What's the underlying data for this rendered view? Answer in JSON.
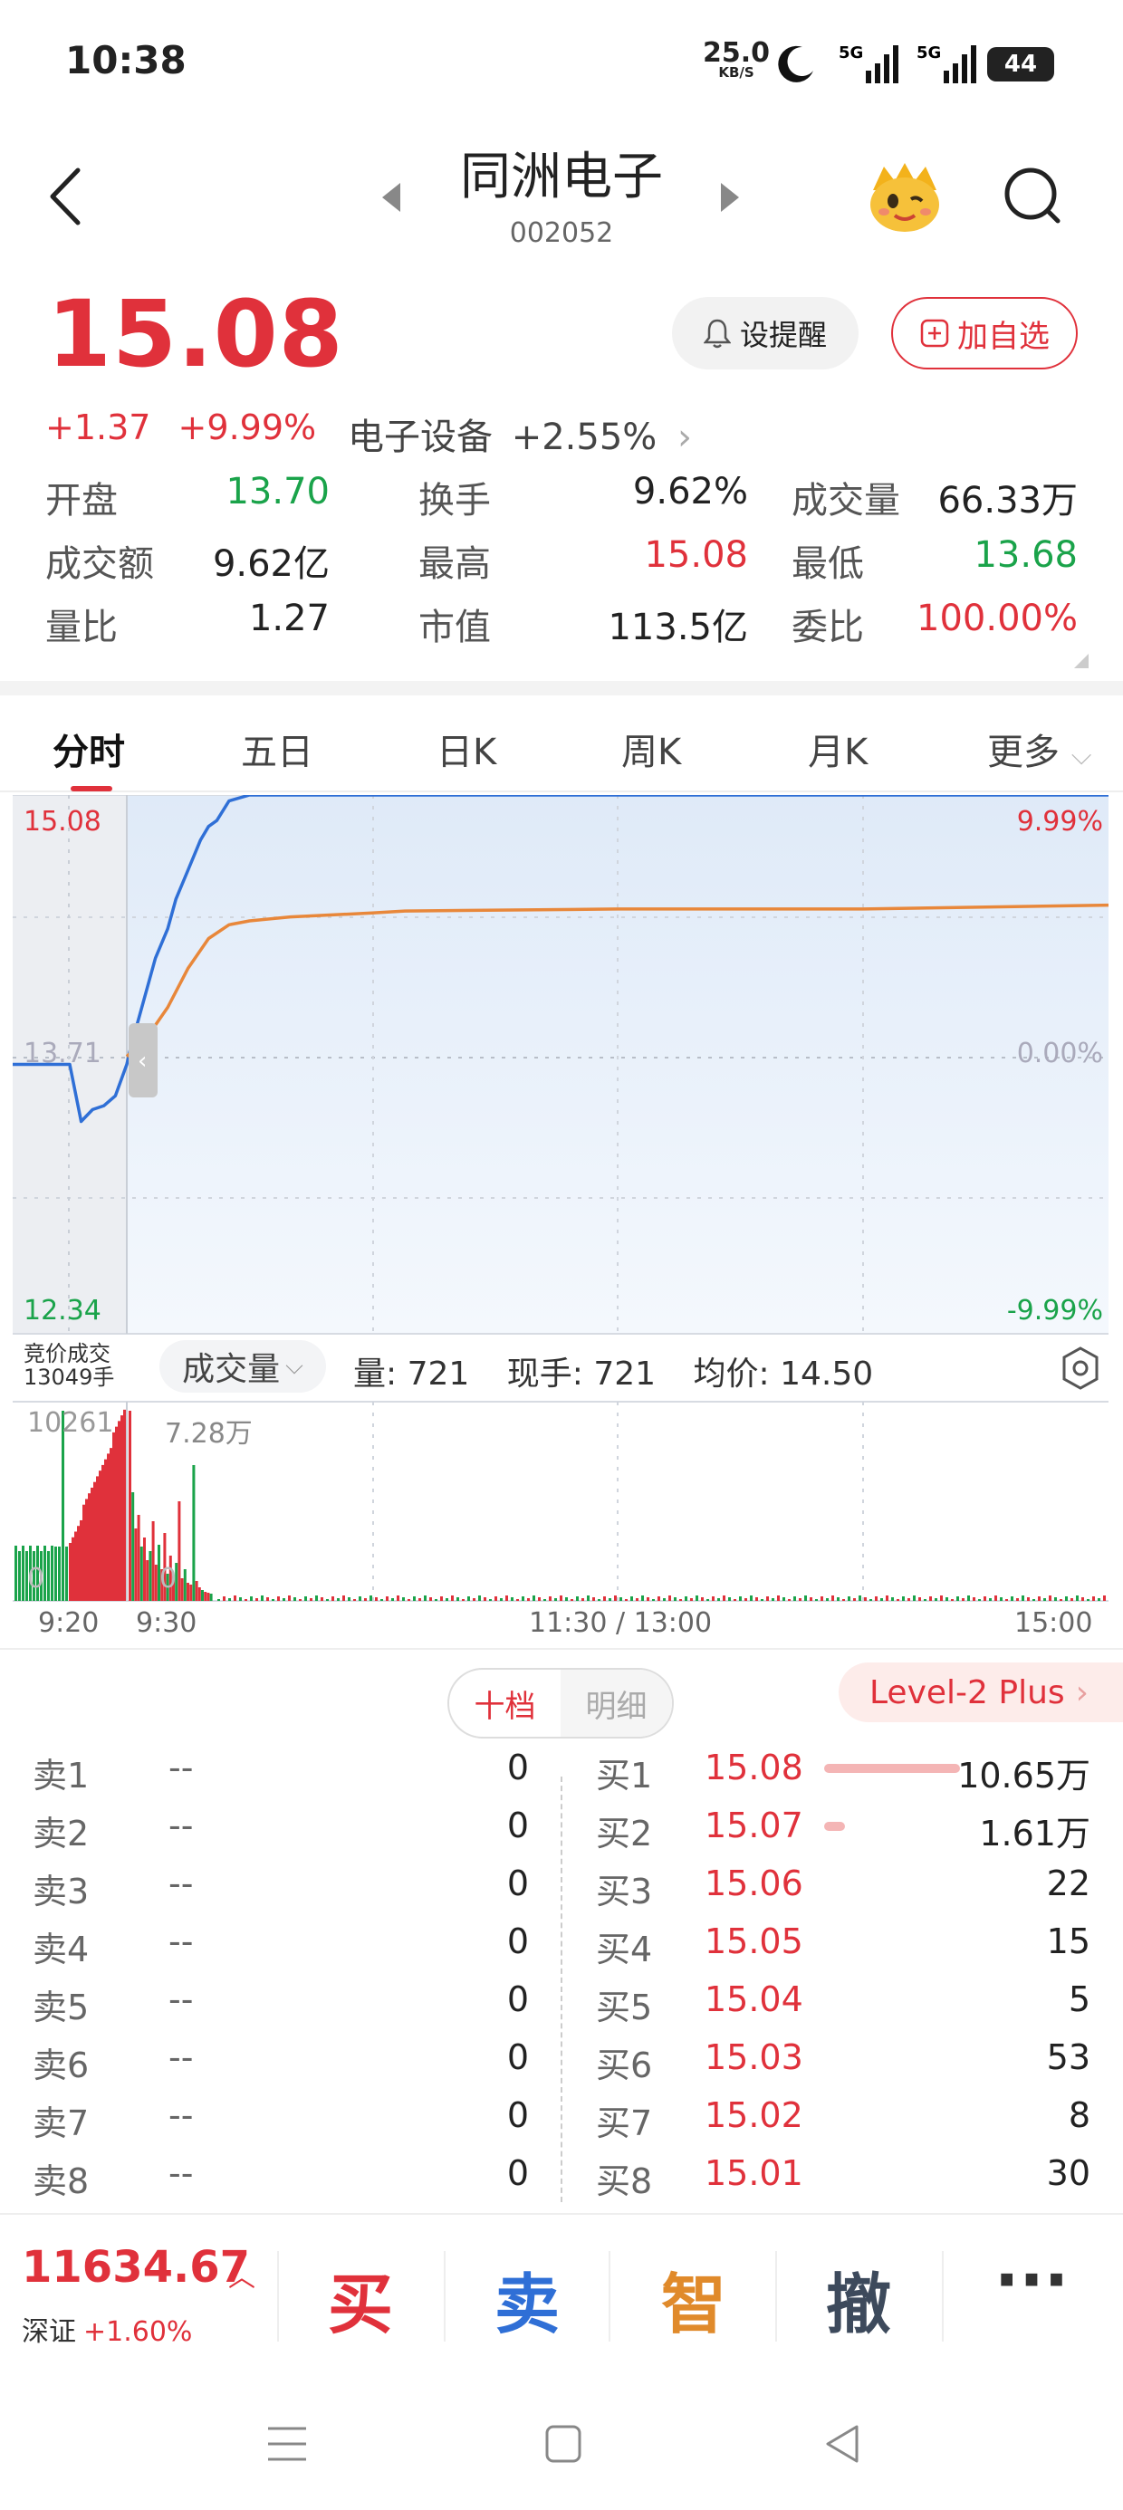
{
  "status": {
    "time": "10:38",
    "speed": "25.0",
    "speed_unit": "KB/S",
    "battery": "44",
    "net1": "5G",
    "net2": "5G"
  },
  "header": {
    "title": "同洲电子",
    "code": "002052"
  },
  "quote": {
    "price": "15.08",
    "change": "+1.37",
    "change_pct": "+9.99%",
    "sector_name": "电子设备",
    "sector_change": "+2.55%",
    "remind_label": "设提醒",
    "add_label": "加自选"
  },
  "stats": [
    [
      {
        "label": "开盘",
        "value": "13.70",
        "color": "green"
      },
      {
        "label": "换手",
        "value": "9.62%",
        "color": "black"
      },
      {
        "label": "成交量",
        "value": "66.33万",
        "color": "black"
      }
    ],
    [
      {
        "label": "成交额",
        "value": "9.62亿",
        "color": "black"
      },
      {
        "label": "最高",
        "value": "15.08",
        "color": "red"
      },
      {
        "label": "最低",
        "value": "13.68",
        "color": "green"
      }
    ],
    [
      {
        "label": "量比",
        "value": "1.27",
        "color": "black"
      },
      {
        "label": "市值",
        "value": "113.5亿",
        "color": "black"
      },
      {
        "label": "委比",
        "value": "100.00%",
        "color": "red"
      }
    ]
  ],
  "tabs": [
    "分时",
    "五日",
    "日K",
    "周K",
    "月K",
    "更多"
  ],
  "chart": {
    "y_top": "15.08",
    "y_mid": "13.71",
    "y_bottom": "12.34",
    "pct_top": "9.99%",
    "pct_mid": "0.00%",
    "pct_bottom": "-9.99%",
    "auction_label": "竞价成交",
    "auction_vol": "13049手",
    "vol_selector": "成交量",
    "vol_info": {
      "vol": "量: 721",
      "now": "现手: 721",
      "avg": "均价: 14.50"
    },
    "vol_max_left": "10261",
    "vol_max_right": "7.28万",
    "vol_zero_left": "0",
    "vol_zero_right": "0",
    "time_labels": [
      "9:20",
      "9:30",
      "11:30 / 13:00",
      "15:00"
    ]
  },
  "chart_data": {
    "type": "line",
    "title": "",
    "ylim": [
      12.34,
      15.08
    ],
    "series": [
      {
        "name": "",
        "color": "#2f6fd6",
        "x": [
          "9:20",
          "9:24",
          "9:25",
          "9:26",
          "9:27",
          "9:28",
          "9:29",
          "9:30",
          "9:31",
          "9:33",
          "9:35",
          "9:37",
          "9:40",
          "9:42",
          "9:45",
          "9:48",
          "9:50",
          "9:52",
          "9:55",
          "10:00",
          "10:38",
          "15:00"
        ],
        "values": [
          13.71,
          13.71,
          13.71,
          13.42,
          13.48,
          13.5,
          13.55,
          13.71,
          13.8,
          13.95,
          14.1,
          14.25,
          14.4,
          14.55,
          14.7,
          14.85,
          14.92,
          14.95,
          15.05,
          15.08,
          15.08,
          15.08
        ]
      },
      {
        "name": "",
        "color": "#e8873a",
        "x": [
          "9:30",
          "9:35",
          "9:40",
          "9:45",
          "9:50",
          "9:55",
          "10:00",
          "10:10",
          "10:30",
          "10:38",
          "11:30",
          "13:00",
          "14:00",
          "15:00"
        ],
        "values": [
          13.75,
          13.85,
          14.0,
          14.2,
          14.35,
          14.42,
          14.44,
          14.46,
          14.48,
          14.49,
          14.5,
          14.5,
          14.5,
          14.52
        ]
      }
    ]
  },
  "orderbook": {
    "tab_on": "十档",
    "tab_off": "明细",
    "level2": "Level-2 Plus",
    "sells": [
      {
        "label": "卖1",
        "price": "--",
        "vol": "0"
      },
      {
        "label": "卖2",
        "price": "--",
        "vol": "0"
      },
      {
        "label": "卖3",
        "price": "--",
        "vol": "0"
      },
      {
        "label": "卖4",
        "price": "--",
        "vol": "0"
      },
      {
        "label": "卖5",
        "price": "--",
        "vol": "0"
      },
      {
        "label": "卖6",
        "price": "--",
        "vol": "0"
      },
      {
        "label": "卖7",
        "price": "--",
        "vol": "0"
      },
      {
        "label": "卖8",
        "price": "--",
        "vol": "0"
      }
    ],
    "buys": [
      {
        "label": "买1",
        "price": "15.08",
        "vol": "10.65万",
        "bar": 1.0
      },
      {
        "label": "买2",
        "price": "15.07",
        "vol": "1.61万",
        "bar": 0.15
      },
      {
        "label": "买3",
        "price": "15.06",
        "vol": "22",
        "bar": 0
      },
      {
        "label": "买4",
        "price": "15.05",
        "vol": "15",
        "bar": 0
      },
      {
        "label": "买5",
        "price": "15.04",
        "vol": "5",
        "bar": 0
      },
      {
        "label": "买6",
        "price": "15.03",
        "vol": "53",
        "bar": 0
      },
      {
        "label": "买7",
        "price": "15.02",
        "vol": "8",
        "bar": 0
      },
      {
        "label": "买8",
        "price": "15.01",
        "vol": "30",
        "bar": 0
      }
    ]
  },
  "bottom": {
    "index_value": "11634.67",
    "index_name": "深证",
    "index_change": "+1.60%",
    "actions": [
      {
        "label": "买",
        "color": "#e0313b"
      },
      {
        "label": "卖",
        "color": "#2f6fd6"
      },
      {
        "label": "智",
        "color": "#e08a2b"
      },
      {
        "label": "撤",
        "color": "#3d4a5c"
      },
      {
        "label": "···",
        "color": "#333333"
      }
    ]
  }
}
